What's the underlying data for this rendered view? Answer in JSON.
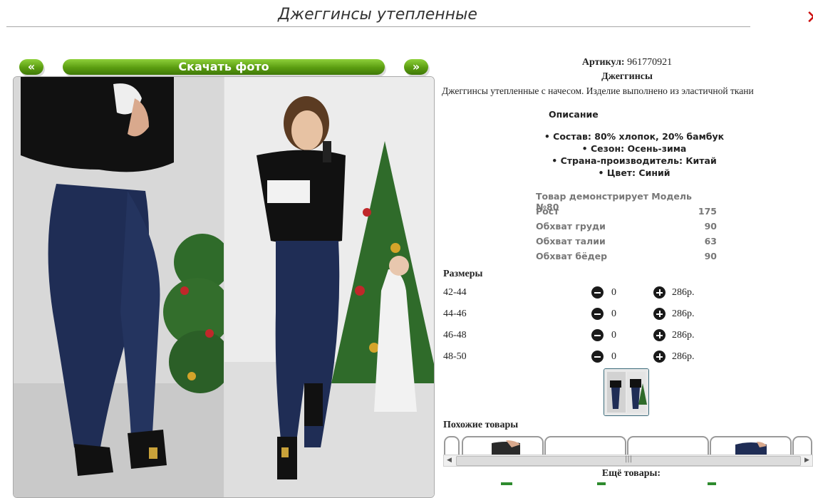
{
  "page": {
    "title": "Джеггинсы утепленные"
  },
  "gallery": {
    "prev_label": "«",
    "download_label": "Скачать фото",
    "next_label": "»"
  },
  "product": {
    "article_label": "Артикул:",
    "article_value": "961770921",
    "type": "Джеггинсы",
    "description": "Джеггинсы утепленные с начесом. Изделие выполнено из эластичной ткани",
    "description_heading": "Описание",
    "features": [
      "• Состав: 80% хлопок, 20% бамбук",
      "• Сезон: Осень-зима",
      "• Страна-производитель: Китай",
      "• Цвет: Синий"
    ]
  },
  "model": {
    "heading": "Товар демонстрирует Модель №80",
    "rows": [
      {
        "label": "Рост",
        "value": "175"
      },
      {
        "label": "Обхват груди",
        "value": "90"
      },
      {
        "label": "Обхват талии",
        "value": "63"
      },
      {
        "label": "Обхват бёдер",
        "value": "90"
      }
    ]
  },
  "sizes": {
    "heading": "Размеры",
    "rows": [
      {
        "size": "42-44",
        "qty": "0",
        "price": "286р."
      },
      {
        "size": "44-46",
        "qty": "0",
        "price": "286р."
      },
      {
        "size": "46-48",
        "qty": "0",
        "price": "286р."
      },
      {
        "size": "48-50",
        "qty": "0",
        "price": "286р."
      }
    ]
  },
  "similar": {
    "heading": "Похожие товары"
  },
  "more": {
    "heading": "Ещё товары:"
  },
  "icons": {
    "minus": "minus-circle-icon",
    "plus": "plus-circle-icon",
    "close": "close-x-icon"
  },
  "colors": {
    "button_green": "#5a9c10",
    "close_red": "#cc1010",
    "model_text": "#777777"
  }
}
